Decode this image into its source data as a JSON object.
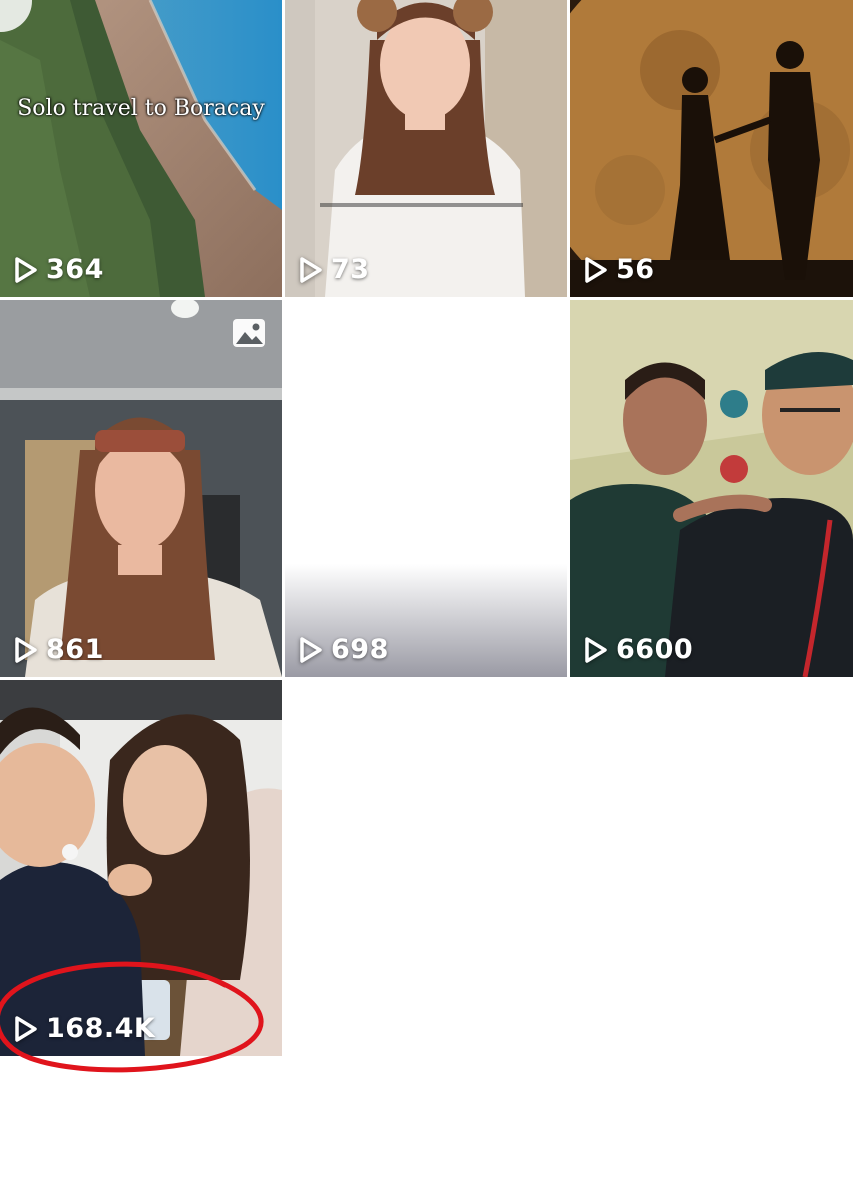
{
  "grid": {
    "items": [
      {
        "views": "364",
        "caption": "Solo travel to Boracay"
      },
      {
        "views": "73"
      },
      {
        "views": "56"
      },
      {
        "views": "861",
        "badge": "photo-icon"
      },
      {
        "views": "698"
      },
      {
        "views": "6600"
      },
      {
        "views": "168.4K",
        "highlighted": true
      }
    ]
  },
  "icons": {
    "play": "play-outline-icon",
    "photo": "photo-icon"
  },
  "colors": {
    "overlay_text": "#ffffff",
    "annotation": "#e0141c"
  }
}
